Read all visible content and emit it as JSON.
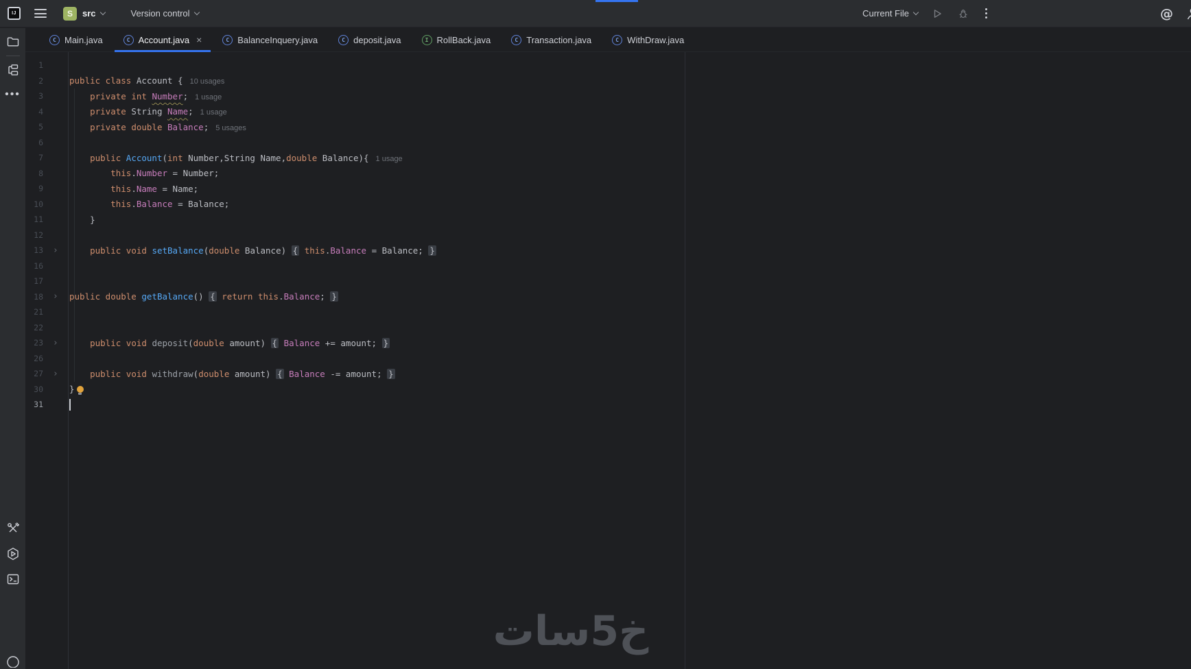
{
  "titlebar": {
    "logo_text": "IJ",
    "project_initial": "S",
    "project_name": "src",
    "version_control_label": "Version control",
    "run_config_label": "Current File"
  },
  "tabs": [
    {
      "label": "Main.java",
      "icon": "class",
      "active": false,
      "closable": false
    },
    {
      "label": "Account.java",
      "icon": "class",
      "active": true,
      "closable": true
    },
    {
      "label": "BalanceInquery.java",
      "icon": "class",
      "active": false,
      "closable": false
    },
    {
      "label": "deposit.java",
      "icon": "class",
      "active": false,
      "closable": false
    },
    {
      "label": "RollBack.java",
      "icon": "interface",
      "active": false,
      "closable": false
    },
    {
      "label": "Transaction.java",
      "icon": "class",
      "active": false,
      "closable": false
    },
    {
      "label": "WithDraw.java",
      "icon": "class",
      "active": false,
      "closable": false
    }
  ],
  "editor": {
    "lines": [
      {
        "num": "1",
        "segs": []
      },
      {
        "num": "2",
        "segs": [
          [
            "kw",
            "public class"
          ],
          [
            "plain",
            " Account {"
          ]
        ],
        "hint": "10 usages"
      },
      {
        "num": "3",
        "segs": [
          [
            "plain",
            "    "
          ],
          [
            "kw",
            "private int"
          ],
          [
            "plain",
            " "
          ],
          [
            "field squiggle",
            "Number"
          ],
          [
            "plain",
            ";"
          ]
        ],
        "hint": "1 usage"
      },
      {
        "num": "4",
        "segs": [
          [
            "plain",
            "    "
          ],
          [
            "kw",
            "private"
          ],
          [
            "plain",
            " String "
          ],
          [
            "field squiggle",
            "Name"
          ],
          [
            "plain",
            ";"
          ]
        ],
        "hint": "1 usage"
      },
      {
        "num": "5",
        "segs": [
          [
            "plain",
            "    "
          ],
          [
            "kw",
            "private double"
          ],
          [
            "plain",
            " "
          ],
          [
            "field",
            "Balance"
          ],
          [
            "plain",
            ";"
          ]
        ],
        "hint": "5 usages"
      },
      {
        "num": "6",
        "segs": []
      },
      {
        "num": "7",
        "segs": [
          [
            "plain",
            "    "
          ],
          [
            "kw",
            "public"
          ],
          [
            "plain",
            " "
          ],
          [
            "decl",
            "Account"
          ],
          [
            "plain",
            "("
          ],
          [
            "kw",
            "int"
          ],
          [
            "plain",
            " Number,String Name,"
          ],
          [
            "kw",
            "double"
          ],
          [
            "plain",
            " Balance){"
          ]
        ],
        "hint": "1 usage"
      },
      {
        "num": "8",
        "segs": [
          [
            "plain",
            "        "
          ],
          [
            "kw",
            "this"
          ],
          [
            "plain",
            "."
          ],
          [
            "field",
            "Number"
          ],
          [
            "plain",
            " = Number;"
          ]
        ]
      },
      {
        "num": "9",
        "segs": [
          [
            "plain",
            "        "
          ],
          [
            "kw",
            "this"
          ],
          [
            "plain",
            "."
          ],
          [
            "field",
            "Name"
          ],
          [
            "plain",
            " = Name;"
          ]
        ]
      },
      {
        "num": "10",
        "segs": [
          [
            "plain",
            "        "
          ],
          [
            "kw",
            "this"
          ],
          [
            "plain",
            "."
          ],
          [
            "field",
            "Balance"
          ],
          [
            "plain",
            " = Balance;"
          ]
        ]
      },
      {
        "num": "11",
        "segs": [
          [
            "plain",
            "    }"
          ]
        ]
      },
      {
        "num": "12",
        "segs": []
      },
      {
        "num": "13",
        "fold": true,
        "segs": [
          [
            "plain",
            "    "
          ],
          [
            "kw",
            "public void"
          ],
          [
            "plain",
            " "
          ],
          [
            "decl",
            "setBalance"
          ],
          [
            "plain",
            "("
          ],
          [
            "kw",
            "double"
          ],
          [
            "plain",
            " Balance) "
          ],
          [
            "foldbox",
            "{"
          ],
          [
            "plain",
            " "
          ],
          [
            "kw",
            "this"
          ],
          [
            "plain",
            "."
          ],
          [
            "field",
            "Balance"
          ],
          [
            "plain",
            " = Balance; "
          ],
          [
            "foldbox",
            "}"
          ]
        ]
      },
      {
        "num": "16",
        "segs": []
      },
      {
        "num": "17",
        "segs": []
      },
      {
        "num": "18",
        "fold": true,
        "segs": [
          [
            "kw",
            "public double"
          ],
          [
            "plain",
            " "
          ],
          [
            "decl",
            "getBalance"
          ],
          [
            "plain",
            "() "
          ],
          [
            "foldbox",
            "{"
          ],
          [
            "plain",
            " "
          ],
          [
            "kw",
            "return"
          ],
          [
            "plain",
            " "
          ],
          [
            "kw",
            "this"
          ],
          [
            "plain",
            "."
          ],
          [
            "field",
            "Balance"
          ],
          [
            "plain",
            "; "
          ],
          [
            "foldbox",
            "}"
          ]
        ]
      },
      {
        "num": "21",
        "segs": []
      },
      {
        "num": "22",
        "segs": []
      },
      {
        "num": "23",
        "fold": true,
        "segs": [
          [
            "plain",
            "    "
          ],
          [
            "kw",
            "public void"
          ],
          [
            "plain",
            " "
          ],
          [
            "gray",
            "deposit"
          ],
          [
            "plain",
            "("
          ],
          [
            "kw",
            "double"
          ],
          [
            "plain",
            " amount) "
          ],
          [
            "foldbox",
            "{"
          ],
          [
            "plain",
            " "
          ],
          [
            "field",
            "Balance"
          ],
          [
            "plain",
            " += amount; "
          ],
          [
            "foldbox",
            "}"
          ]
        ]
      },
      {
        "num": "26",
        "segs": []
      },
      {
        "num": "27",
        "fold": true,
        "segs": [
          [
            "plain",
            "    "
          ],
          [
            "kw",
            "public void"
          ],
          [
            "plain",
            " "
          ],
          [
            "gray",
            "withdraw"
          ],
          [
            "plain",
            "("
          ],
          [
            "kw",
            "double"
          ],
          [
            "plain",
            " amount) "
          ],
          [
            "foldbox",
            "{"
          ],
          [
            "plain",
            " "
          ],
          [
            "field",
            "Balance"
          ],
          [
            "plain",
            " -= amount; "
          ],
          [
            "foldbox",
            "}"
          ]
        ]
      },
      {
        "num": "30",
        "bulb": true,
        "segs": [
          [
            "plain",
            "}"
          ]
        ]
      },
      {
        "num": "31",
        "caret": true,
        "active": true,
        "segs": []
      }
    ]
  },
  "watermark": "خ5سات",
  "colors": {
    "accent_blue": "#3574f0",
    "titlebar_bg": "#2b2d30",
    "editor_bg": "#1e1f22",
    "keyword": "#cf8e6d",
    "method_decl": "#56a8f5",
    "field": "#c77dbb",
    "plain_text": "#bcbec4",
    "hint_gray": "#6f737a",
    "project_badge_green": "#9eb463"
  }
}
